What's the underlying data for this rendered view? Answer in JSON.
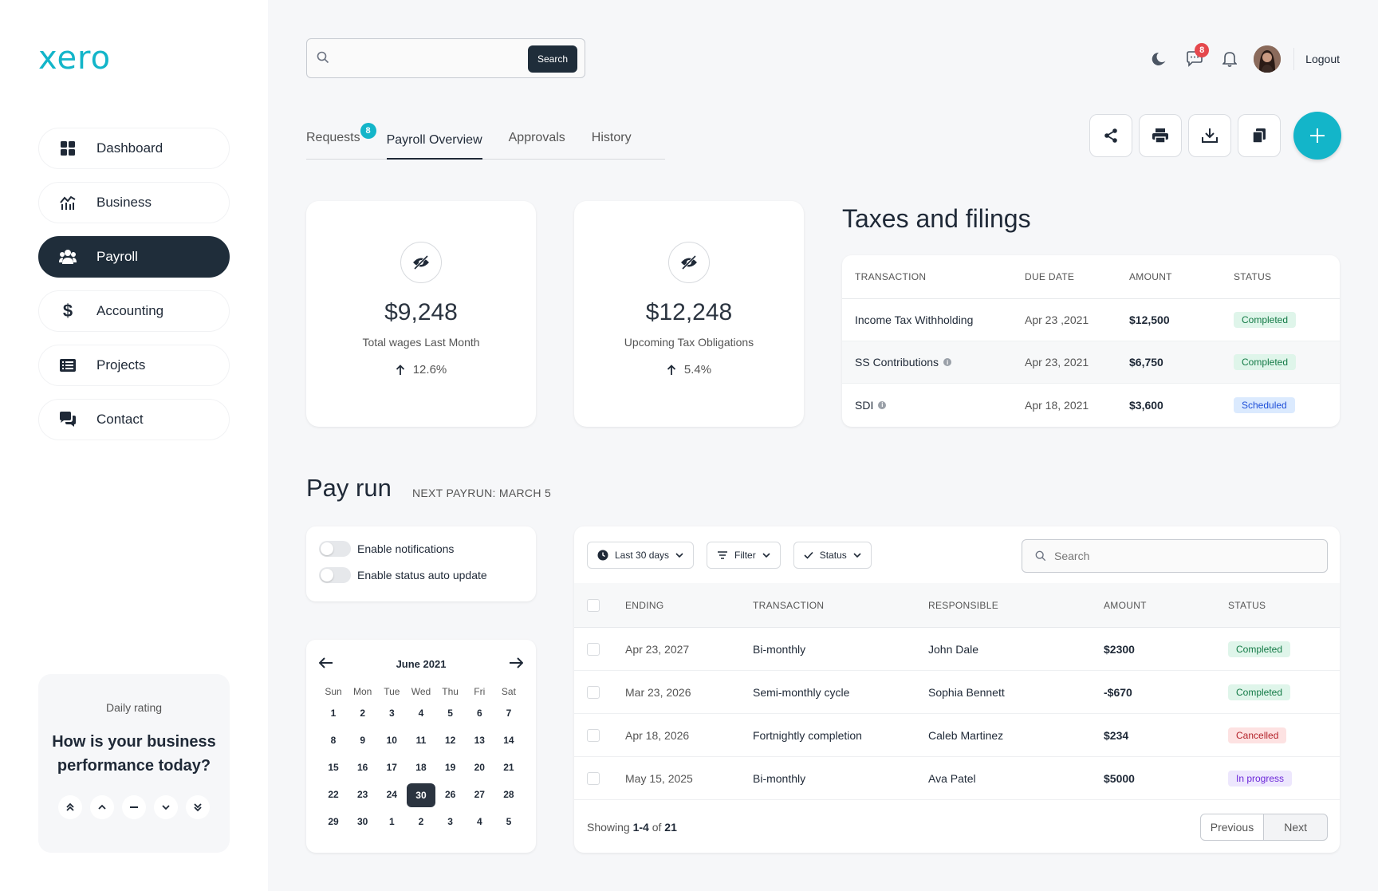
{
  "app": {
    "logo": "xero"
  },
  "sidebar": {
    "items": [
      {
        "label": "Dashboard",
        "icon": "grid-icon"
      },
      {
        "label": "Business",
        "icon": "chart-icon"
      },
      {
        "label": "Payroll",
        "icon": "users-icon",
        "active": true
      },
      {
        "label": "Accounting",
        "icon": "dollar-icon"
      },
      {
        "label": "Projects",
        "icon": "list-icon"
      },
      {
        "label": "Contact",
        "icon": "chat-icon"
      }
    ],
    "rating": {
      "label": "Daily rating",
      "question": "How is your business performance today?"
    }
  },
  "header": {
    "search_button": "Search",
    "messages_count": "8",
    "logout": "Logout"
  },
  "tabs": [
    {
      "label": "Requests",
      "badge": "8"
    },
    {
      "label": "Payroll Overview",
      "active": true
    },
    {
      "label": "Approvals"
    },
    {
      "label": "History"
    }
  ],
  "stats": [
    {
      "value": "$9,248",
      "label": "Total wages Last Month",
      "change": "12.6%"
    },
    {
      "value": "$12,248",
      "label": "Upcoming Tax Obligations",
      "change": "5.4%"
    }
  ],
  "taxes": {
    "title": "Taxes and filings",
    "columns": [
      "TRANSACTION",
      "DUE DATE",
      "AMOUNT",
      "STATUS"
    ],
    "rows": [
      {
        "transaction": "Income Tax Withholding",
        "due": "Apr 23 ,2021",
        "amount": "$12,500",
        "status": "Completed"
      },
      {
        "transaction": "SS Contributions",
        "due": "Apr 23, 2021",
        "amount": "$6,750",
        "status": "Completed"
      },
      {
        "transaction": "SDI",
        "due": "Apr 18, 2021",
        "amount": "$3,600",
        "status": "Scheduled"
      }
    ]
  },
  "payrun": {
    "title": "Pay run",
    "next": "NEXT PAYRUN: MARCH 5",
    "toggles": [
      "Enable notifications",
      "Enable status auto update"
    ],
    "calendar": {
      "month": "June 2021",
      "dow": [
        "Sun",
        "Mon",
        "Tue",
        "Wed",
        "Thu",
        "Fri",
        "Sat"
      ],
      "days": [
        "1",
        "2",
        "3",
        "4",
        "5",
        "6",
        "7",
        "8",
        "9",
        "10",
        "11",
        "12",
        "13",
        "14",
        "15",
        "16",
        "17",
        "18",
        "19",
        "20",
        "21",
        "22",
        "23",
        "24",
        "30",
        "26",
        "27",
        "28",
        "29",
        "30",
        "1",
        "2",
        "3",
        "4",
        "5"
      ],
      "selected_index": 24
    },
    "filters": [
      "Last 30 days",
      "Filter",
      "Status"
    ],
    "search_placeholder": "Search",
    "columns": [
      "ENDING",
      "TRANSACTION",
      "RESPONSIBLE",
      "AMOUNT",
      "STATUS"
    ],
    "rows": [
      {
        "ending": "Apr 23, 2027",
        "transaction": "Bi-monthly",
        "responsible": "John Dale",
        "amount": "$2300",
        "status": "Completed"
      },
      {
        "ending": "Mar 23, 2026",
        "transaction": "Semi-monthly cycle",
        "responsible": "Sophia Bennett",
        "amount": "-$670",
        "status": "Completed"
      },
      {
        "ending": "Apr 18, 2026",
        "transaction": "Fortnightly completion",
        "responsible": "Caleb Martinez",
        "amount": "$234",
        "status": "Cancelled"
      },
      {
        "ending": "May 15, 2025",
        "transaction": "Bi-monthly",
        "responsible": "Ava Patel",
        "amount": "$5000",
        "status": "In progress"
      }
    ],
    "footer": {
      "showing_prefix": "Showing",
      "range": "1-4",
      "of": "of",
      "total": "21"
    },
    "pager": {
      "previous": "Previous",
      "next": "Next"
    }
  },
  "colors": {
    "accent": "#13b5c9",
    "dark": "#1f2d3a",
    "badge_red": "#e5484d"
  }
}
